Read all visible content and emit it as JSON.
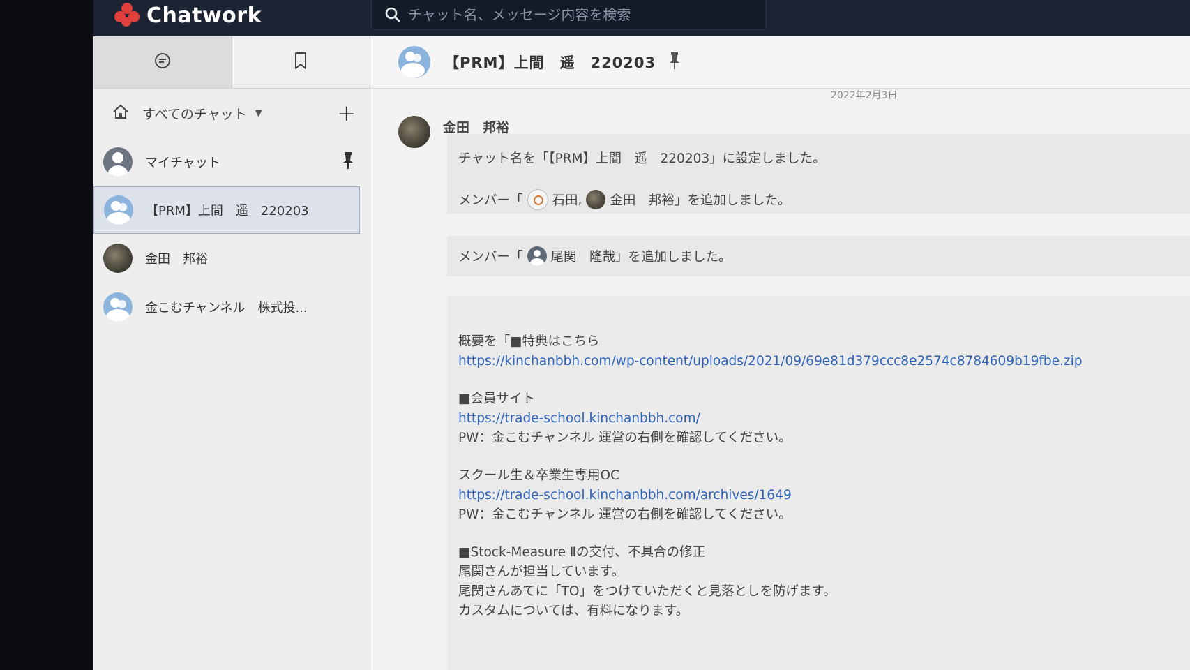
{
  "app": {
    "name": "Chatwork"
  },
  "search": {
    "placeholder": "チャット名、メッセージ内容を検索"
  },
  "sidebar": {
    "filter_label": "すべてのチャット",
    "rooms": [
      {
        "name": "マイチャット"
      },
      {
        "name": "【PRM】上間　遥　220203"
      },
      {
        "name": "金田　邦裕"
      },
      {
        "name": "金こむチャンネル　株式投..."
      }
    ]
  },
  "room": {
    "title": "【PRM】上間　遥　220203"
  },
  "messages": {
    "date": "2022年2月3日",
    "sender": "金田　邦裕",
    "rename_notice": "チャット名を「【PRM】上間　遥　220203」に設定しました。",
    "member_add_1": {
      "prefix": "メンバー「",
      "m1": "石田",
      "sep": ",",
      "m2": "金田　邦裕",
      "suffix": "」を追加しました。"
    },
    "member_add_2": {
      "prefix": "メンバー「",
      "m1": "尾関　隆哉",
      "suffix": "」を追加しました。"
    },
    "summary": {
      "l1": "概要を「■特典はこちら",
      "link1": "https://kinchanbbh.com/wp-content/uploads/2021/09/69e81d379ccc8e2574c8784609b19fbe.zip",
      "l3": "■会員サイト",
      "link2": "https://trade-school.kinchanbbh.com/",
      "pw1": "PW：金こむチャンネル 運営の右側を確認してください。",
      "l6": "スクール生＆卒業生専用OC",
      "link3": "https://trade-school.kinchanbbh.com/archives/1649",
      "pw2": "PW：金こむチャンネル 運営の右側を確認してください。",
      "l9": "■Stock-Measure Ⅱの交付、不具合の修正",
      "l10": "尾関さんが担当しています。",
      "l11": "尾関さんあてに「TO」をつけていただくと見落としを防げます。",
      "l12": "カスタムについては、有料になります。"
    }
  },
  "colors": {
    "topbar": "#1c2433",
    "accent": "#e0403b",
    "link": "#2f63b8"
  }
}
